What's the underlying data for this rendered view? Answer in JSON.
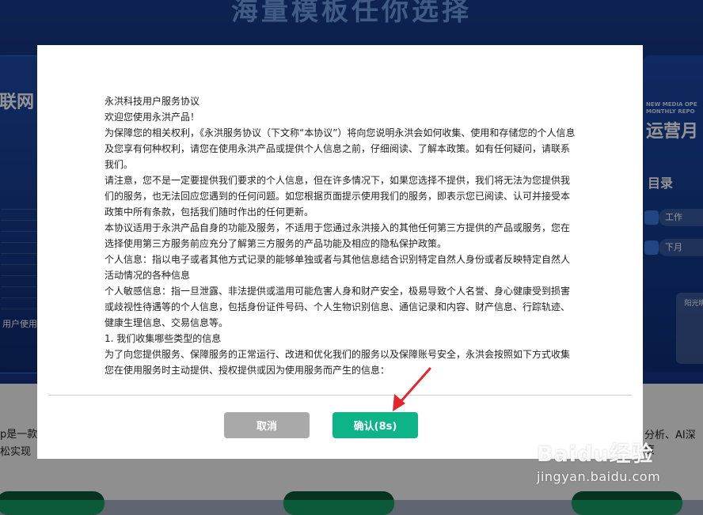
{
  "background": {
    "headline": "海量模板任你选择",
    "left_card": {
      "title": "联网",
      "label": "用户使用"
    },
    "right_card": {
      "en_title": "NEW MEDIA OPE\nMONTHLY REPO",
      "title": "运营月",
      "subtitle": "目录",
      "item1": "工作",
      "item2": "下月",
      "badge": "阳光明"
    },
    "bottom_left_text_1": "p是一款",
    "bottom_left_text_2": "松实现",
    "bottom_right_text": "分析、AI深度"
  },
  "modal": {
    "paragraphs": [
      "永洪科技用户服务协议",
      "欢迎您使用永洪产品！",
      "为保障您的相关权利，《永洪服务协议（下文称“本协议”）将向您说明永洪会如何收集、使用和存储您的个人信息及您享有何种权利，请您在使用永洪产品或提供个人信息之前，仔细阅读、了解本政策。如有任何疑问，请联系我们。",
      "请注意，您不是一定要提供我们要求的个人信息，但在许多情况下，如果您选择不提供，我们将无法为您提供我们的服务，也无法回应您遇到的任何问题。如您根据页面提示使用我们的服务，即表示您已阅读、认可并接受本政策中所有条款，包括我们随时作出的任何更新。",
      "本协议适用于永洪产品自身的功能及服务，不适用于您通过永洪接入的其他任何第三方提供的产品或服务，您在选择使用第三方服务前应充分了解第三方服务的产品功能及相应的隐私保护政策。",
      "个人信息：指以电子或者其他方式记录的能够单独或者与其他信息结合识别特定自然人身份或者反映特定自然人活动情况的各种信息",
      "个人敏感信息：指一旦泄露、非法提供或滥用可能危害人身和财产安全，极易导致个人名誉、身心健康受到损害或歧视性待遇等的个人信息，包括身份证件号码、个人生物识别信息、通信记录和内容、财产信息、行踪轨迹、健康生理信息、交易信息等。",
      "1. 我们收集哪些类型的信息",
      "为了向您提供服务、保障服务的正常运行、改进和优化我们的服务以及保障账号安全，永洪会按照如下方式收集您在使用服务时主动提供、授权提供或因为使用服务而产生的信息："
    ],
    "cancel_label": "取消",
    "confirm_label": "确认(8s)"
  },
  "colors": {
    "confirm": "#0db488",
    "cancel": "#a9a9a9",
    "annotation_arrow": "#e3262b"
  },
  "watermark": {
    "logo": "Baidu经验",
    "url": "jingyan.baidu.com"
  }
}
